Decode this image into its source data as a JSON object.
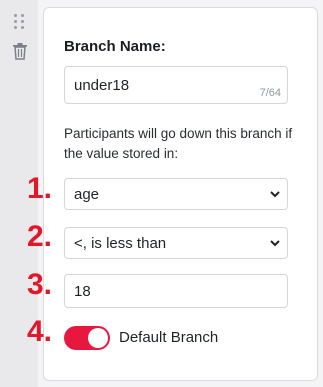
{
  "branch": {
    "title": "Branch Name:",
    "name_value": "under18",
    "counter": "7/64",
    "help_text": "Participants will go down this branch if the value stored in:"
  },
  "condition": {
    "variable": "age",
    "operator": "<, is less than",
    "value": "18"
  },
  "default_toggle": {
    "label": "Default Branch",
    "on": true
  },
  "step_labels": [
    "1.",
    "2.",
    "3.",
    "4."
  ],
  "colors": {
    "accent": "#e8173d",
    "step_red": "#e0182a"
  },
  "icons": [
    "drag-handle-icon",
    "trash-icon",
    "chevron-down-icon"
  ]
}
